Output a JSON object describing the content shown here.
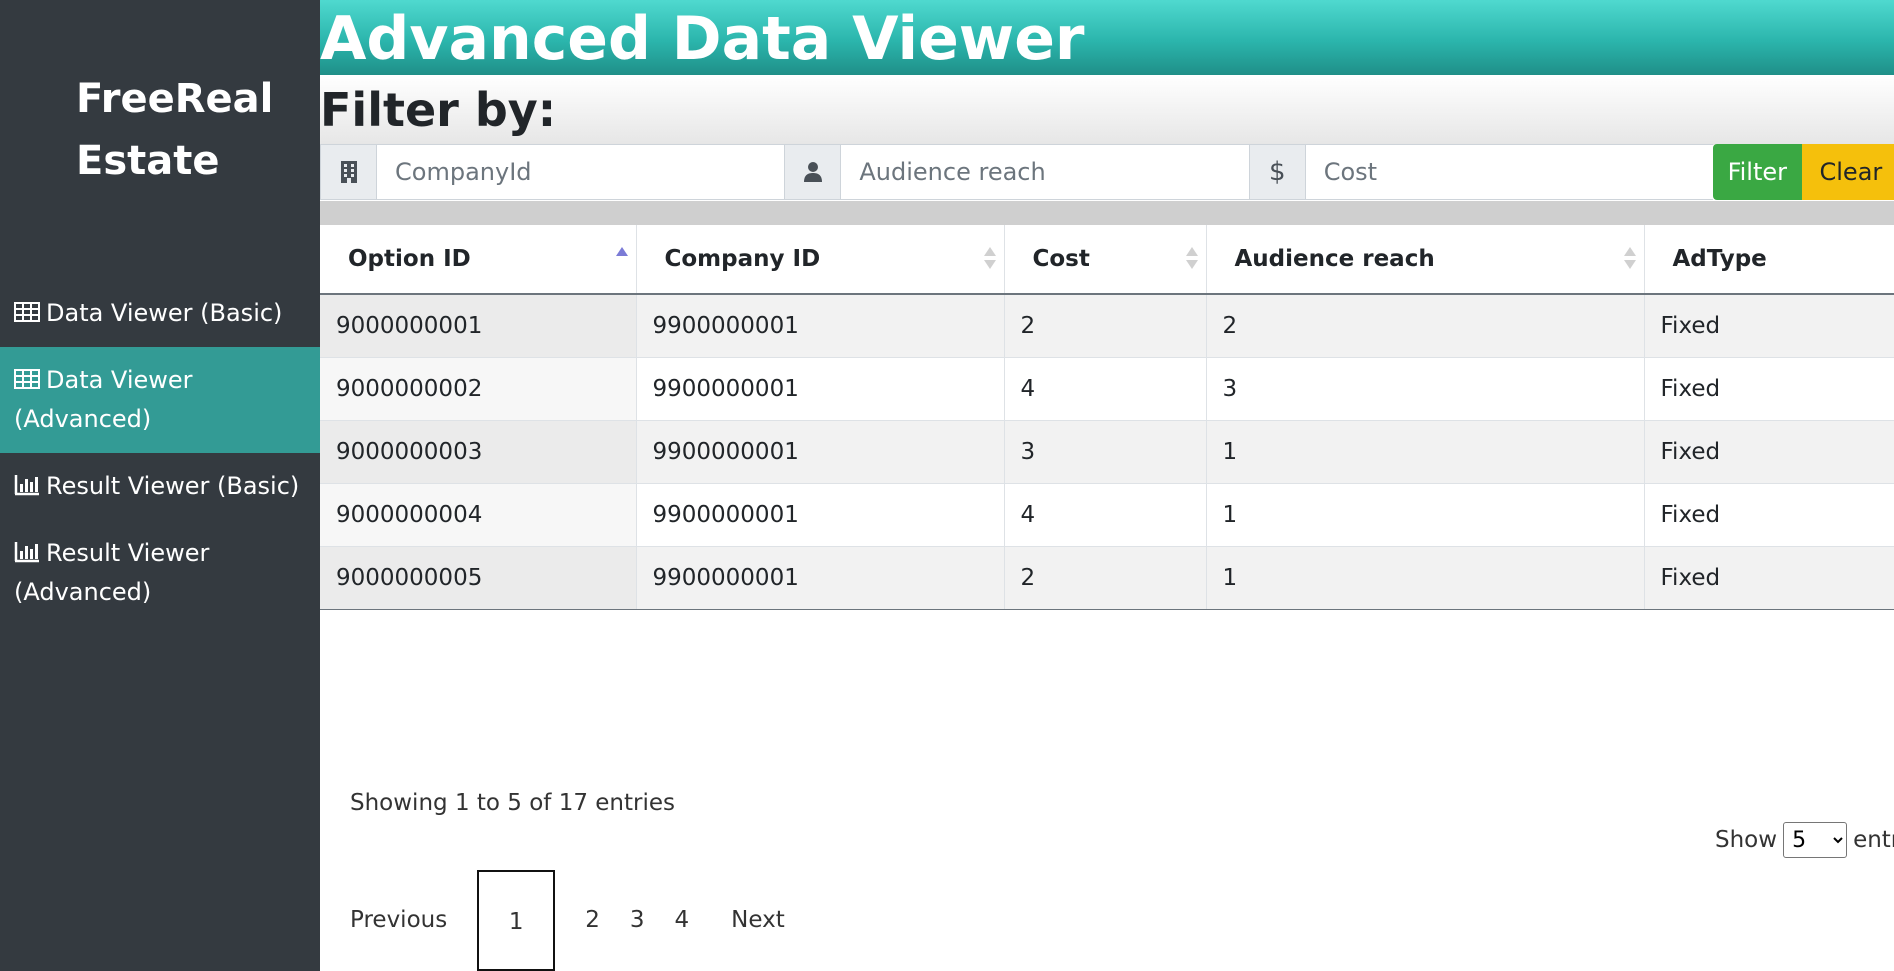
{
  "sidebar": {
    "brand_line1": "FreeReal",
    "brand_line2": "Estate",
    "items": [
      {
        "label": "Data Viewer (Basic)",
        "icon": "table-icon",
        "active": false
      },
      {
        "label": "Data Viewer (Advanced)",
        "icon": "table-icon",
        "active": true
      },
      {
        "label": "Result Viewer (Basic)",
        "icon": "bar-chart-icon",
        "active": false
      },
      {
        "label": "Result Viewer (Advanced)",
        "icon": "bar-chart-icon",
        "active": false
      }
    ]
  },
  "header": {
    "title": "Advanced Data Viewer"
  },
  "filter": {
    "title": "Filter by:",
    "company_placeholder": "CompanyId",
    "audience_placeholder": "Audience reach",
    "cost_placeholder": "Cost",
    "cost_symbol": "$",
    "filter_label": "Filter",
    "clear_label": "Clear"
  },
  "table": {
    "columns": [
      "Option ID",
      "Company ID",
      "Cost",
      "Audience reach",
      "AdType"
    ],
    "rows": [
      [
        "9000000001",
        "9900000001",
        "2",
        "2",
        "Fixed"
      ],
      [
        "9000000002",
        "9900000001",
        "4",
        "3",
        "Fixed"
      ],
      [
        "9000000003",
        "9900000001",
        "3",
        "1",
        "Fixed"
      ],
      [
        "9000000004",
        "9900000001",
        "4",
        "1",
        "Fixed"
      ],
      [
        "9000000005",
        "9900000001",
        "2",
        "1",
        "Fixed"
      ]
    ]
  },
  "footer": {
    "info": "Showing 1 to 5 of 17 entries",
    "show_label": "Show",
    "show_value": "5",
    "entries_label": "entries",
    "pagination": {
      "previous": "Previous",
      "pages": [
        "1",
        "2",
        "3",
        "4"
      ],
      "current": "1",
      "next": "Next"
    }
  },
  "colors": {
    "sidebar_bg": "#343a40",
    "active_item": "#339b95",
    "header_accent": "#2bb5ac",
    "filter_button": "#3aa843",
    "clear_button": "#f5c00c"
  }
}
